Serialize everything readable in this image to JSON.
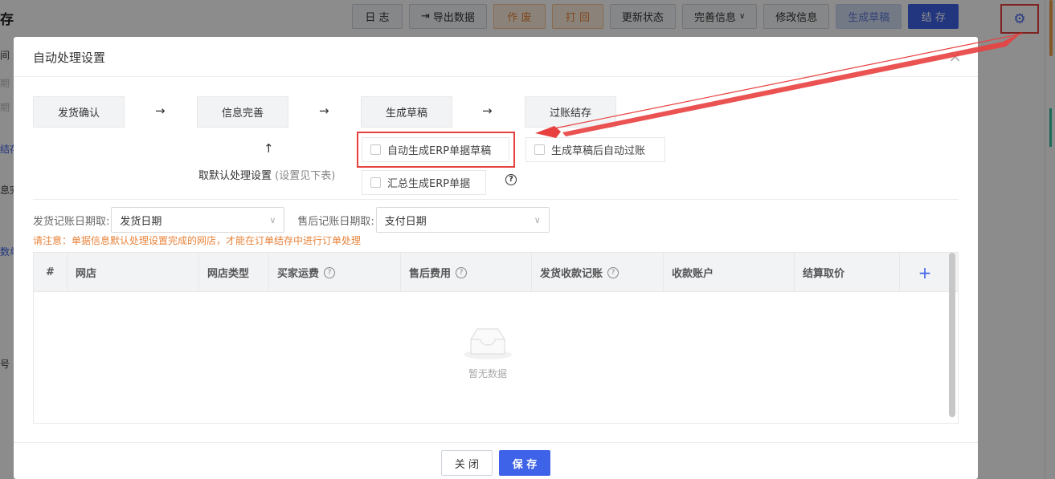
{
  "background": {
    "page_title": "存",
    "toolbar": [
      {
        "label": "日 志",
        "style": "default"
      },
      {
        "label": "导出数据",
        "style": "default",
        "icon": "export-icon"
      },
      {
        "label": "作 废",
        "style": "warn"
      },
      {
        "label": "打 回",
        "style": "warn"
      },
      {
        "label": "更新状态",
        "style": "default"
      },
      {
        "label": "完善信息",
        "style": "default",
        "icon": "chevron-down-icon"
      },
      {
        "label": "修改信息",
        "style": "default"
      },
      {
        "label": "生成草稿",
        "style": "draft"
      },
      {
        "label": "结 存",
        "style": "primary"
      }
    ],
    "settings_icon": "gear-icon",
    "left_labels": [
      "间",
      "期",
      "期",
      "结存",
      "息完",
      "数单",
      "号"
    ]
  },
  "modal": {
    "title": "自动处理设置",
    "close_icon": "close-icon",
    "flow": {
      "steps": [
        "发货确认",
        "信息完善",
        "生成草稿",
        "过账结存"
      ],
      "default_setting_label": "取默认处理设置",
      "default_setting_hint": "(设置见下表)",
      "options": {
        "auto_generate_erp_draft": {
          "label": "自动生成ERP单据草稿",
          "checked": false
        },
        "auto_post_after_draft": {
          "label": "生成草稿后自动过账",
          "checked": false
        },
        "summary_generate_erp": {
          "label": "汇总生成ERP单据",
          "checked": false
        }
      }
    },
    "filters": {
      "shipping_label": "发货记账日期取:",
      "shipping_value": "发货日期",
      "aftersale_label": "售后记账日期取:",
      "aftersale_value": "支付日期"
    },
    "notice": "请注意：单据信息默认处理设置完成的网店，才能在订单结存中进行订单处理",
    "table": {
      "columns": [
        "#",
        "网店",
        "网店类型",
        "买家运费",
        "售后费用",
        "发货收款记账",
        "收款账户",
        "结算取价"
      ],
      "empty_text": "暂无数据"
    },
    "footer": {
      "close_label": "关 闭",
      "save_label": "保 存"
    }
  },
  "colors": {
    "primary": "#3f63e8",
    "warn": "#e8833a",
    "annotation_red": "#e8403f"
  }
}
